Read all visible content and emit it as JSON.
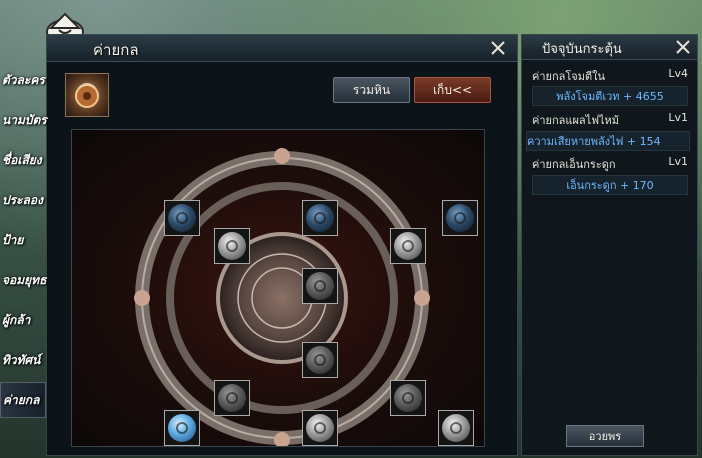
{
  "main_window": {
    "title": "ค่ายกล",
    "gather_button": "รวมหิน",
    "store_button": "เก็บ<<"
  },
  "sidebar": {
    "items": [
      {
        "label": "ตัวละคร"
      },
      {
        "label": "นามบัตร"
      },
      {
        "label": "ชื่อเสียง"
      },
      {
        "label": "ประลอง"
      },
      {
        "label": "ป้าย"
      },
      {
        "label": "จอมยุทธ"
      },
      {
        "label": "ผู้กล้า"
      },
      {
        "label": "ทิวทัศน์"
      },
      {
        "label": "ค่ายกล",
        "active": true
      }
    ]
  },
  "side_panel": {
    "title": "ปัจจุบันกระตุ้น",
    "buffs": [
      {
        "name": "ค่ายกลโจมตีใน",
        "level": "Lv4",
        "effect": "พลังโจมตีเวท + 4655"
      },
      {
        "name": "ค่ายกลแผลไฟไหม้",
        "level": "Lv1",
        "effect": "ความเสียหายพลังไฟ + 154"
      },
      {
        "name": "ค่ายกลเอ็นกระดูก",
        "level": "Lv1",
        "effect": "เอ็นกระดูก + 170"
      }
    ],
    "bless_button": "อวยพร"
  },
  "slots": [
    {
      "gem": "blue"
    },
    {
      "gem": "silver"
    },
    {
      "gem": "blue"
    },
    {
      "gem": "silver"
    },
    {
      "gem": "blue"
    },
    {
      "gem": "dark"
    },
    {
      "gem": "dark"
    },
    {
      "gem": "dark"
    },
    {
      "gem": "dark"
    },
    {
      "gem": "bright-blue"
    },
    {
      "gem": "silver"
    },
    {
      "gem": "silver"
    }
  ],
  "colors": {
    "effect_text": "#6fb8ff",
    "store_button": "#7a3a2a",
    "panel_bg": "#0d1419"
  }
}
